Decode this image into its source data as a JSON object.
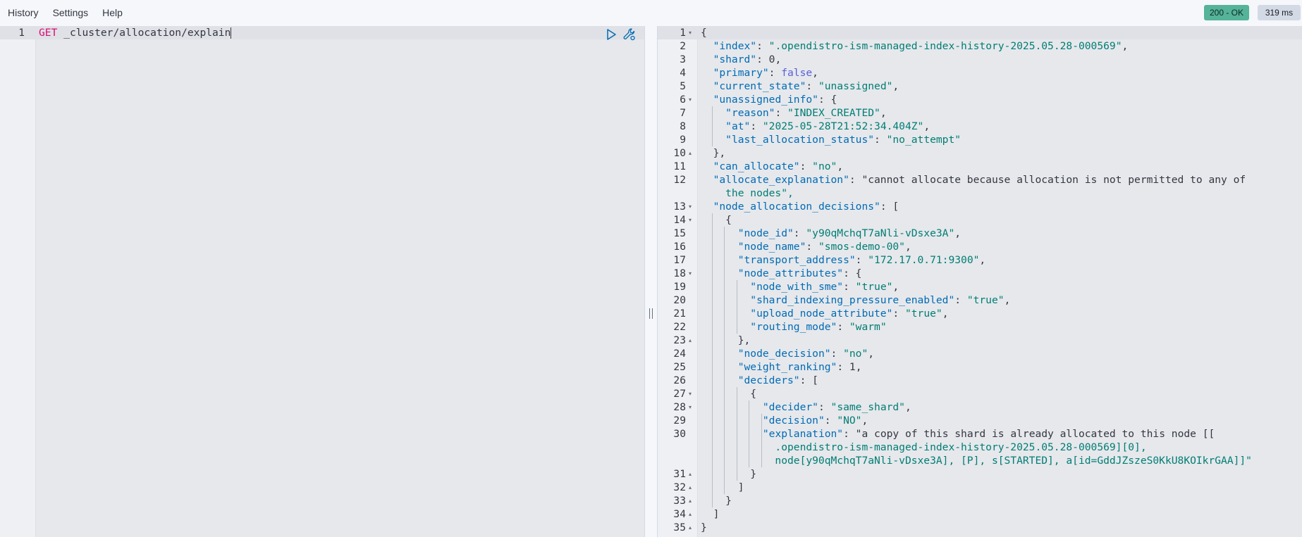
{
  "menu": {
    "items": [
      "History",
      "Settings",
      "Help"
    ]
  },
  "status": {
    "code": "200 - OK",
    "time": "319 ms"
  },
  "request": {
    "line_number": "1",
    "method": "GET",
    "path": "_cluster/allocation/explain"
  },
  "icons": {
    "run": "play-icon",
    "wrench": "wrench-icon",
    "resize": "resize-handle-icon"
  },
  "response": {
    "line_numbers": [
      "1",
      "2",
      "3",
      "4",
      "5",
      "6",
      "7",
      "8",
      "9",
      "10",
      "11",
      "12",
      "13",
      "14",
      "15",
      "16",
      "17",
      "18",
      "19",
      "20",
      "21",
      "22",
      "23",
      "24",
      "25",
      "26",
      "27",
      "28",
      "29",
      "30",
      "31",
      "32",
      "33",
      "34",
      "35"
    ],
    "lines": [
      "{",
      "  \"index\": \".opendistro-ism-managed-index-history-2025.05.28-000569\",",
      "  \"shard\": 0,",
      "  \"primary\": false,",
      "  \"current_state\": \"unassigned\",",
      "  \"unassigned_info\": {",
      "    \"reason\": \"INDEX_CREATED\",",
      "    \"at\": \"2025-05-28T21:52:34.404Z\",",
      "    \"last_allocation_status\": \"no_attempt\"",
      "  },",
      "  \"can_allocate\": \"no\",",
      "  \"allocate_explanation\": \"cannot allocate because allocation is not permitted to any of",
      "    the nodes\",",
      "  \"node_allocation_decisions\": [",
      "    {",
      "      \"node_id\": \"y90qMchqT7aNli-vDsxe3A\",",
      "      \"node_name\": \"smos-demo-00\",",
      "      \"transport_address\": \"172.17.0.71:9300\",",
      "      \"node_attributes\": {",
      "        \"node_with_sme\": \"true\",",
      "        \"shard_indexing_pressure_enabled\": \"true\",",
      "        \"upload_node_attribute\": \"true\",",
      "        \"routing_mode\": \"warm\"",
      "      },",
      "      \"node_decision\": \"no\",",
      "      \"weight_ranking\": 1,",
      "      \"deciders\": [",
      "        {",
      "          \"decider\": \"same_shard\",",
      "          \"decision\": \"NO\",",
      "          \"explanation\": \"a copy of this shard is already allocated to this node [[",
      "            .opendistro-ism-managed-index-history-2025.05.28-000569][0],",
      "            node[y90qMchqT7aNli-vDsxe3A], [P], s[STARTED], a[id=GddJZszeS0KkU8KOIkrGAA]]\"",
      "        }",
      "      ]",
      "    }",
      "  ]",
      "}"
    ]
  },
  "colors": {
    "ok_badge": "#54b399",
    "time_badge": "#d3dae6",
    "key": "#006bb4",
    "string": "#017d73",
    "method": "#dd0a73"
  }
}
